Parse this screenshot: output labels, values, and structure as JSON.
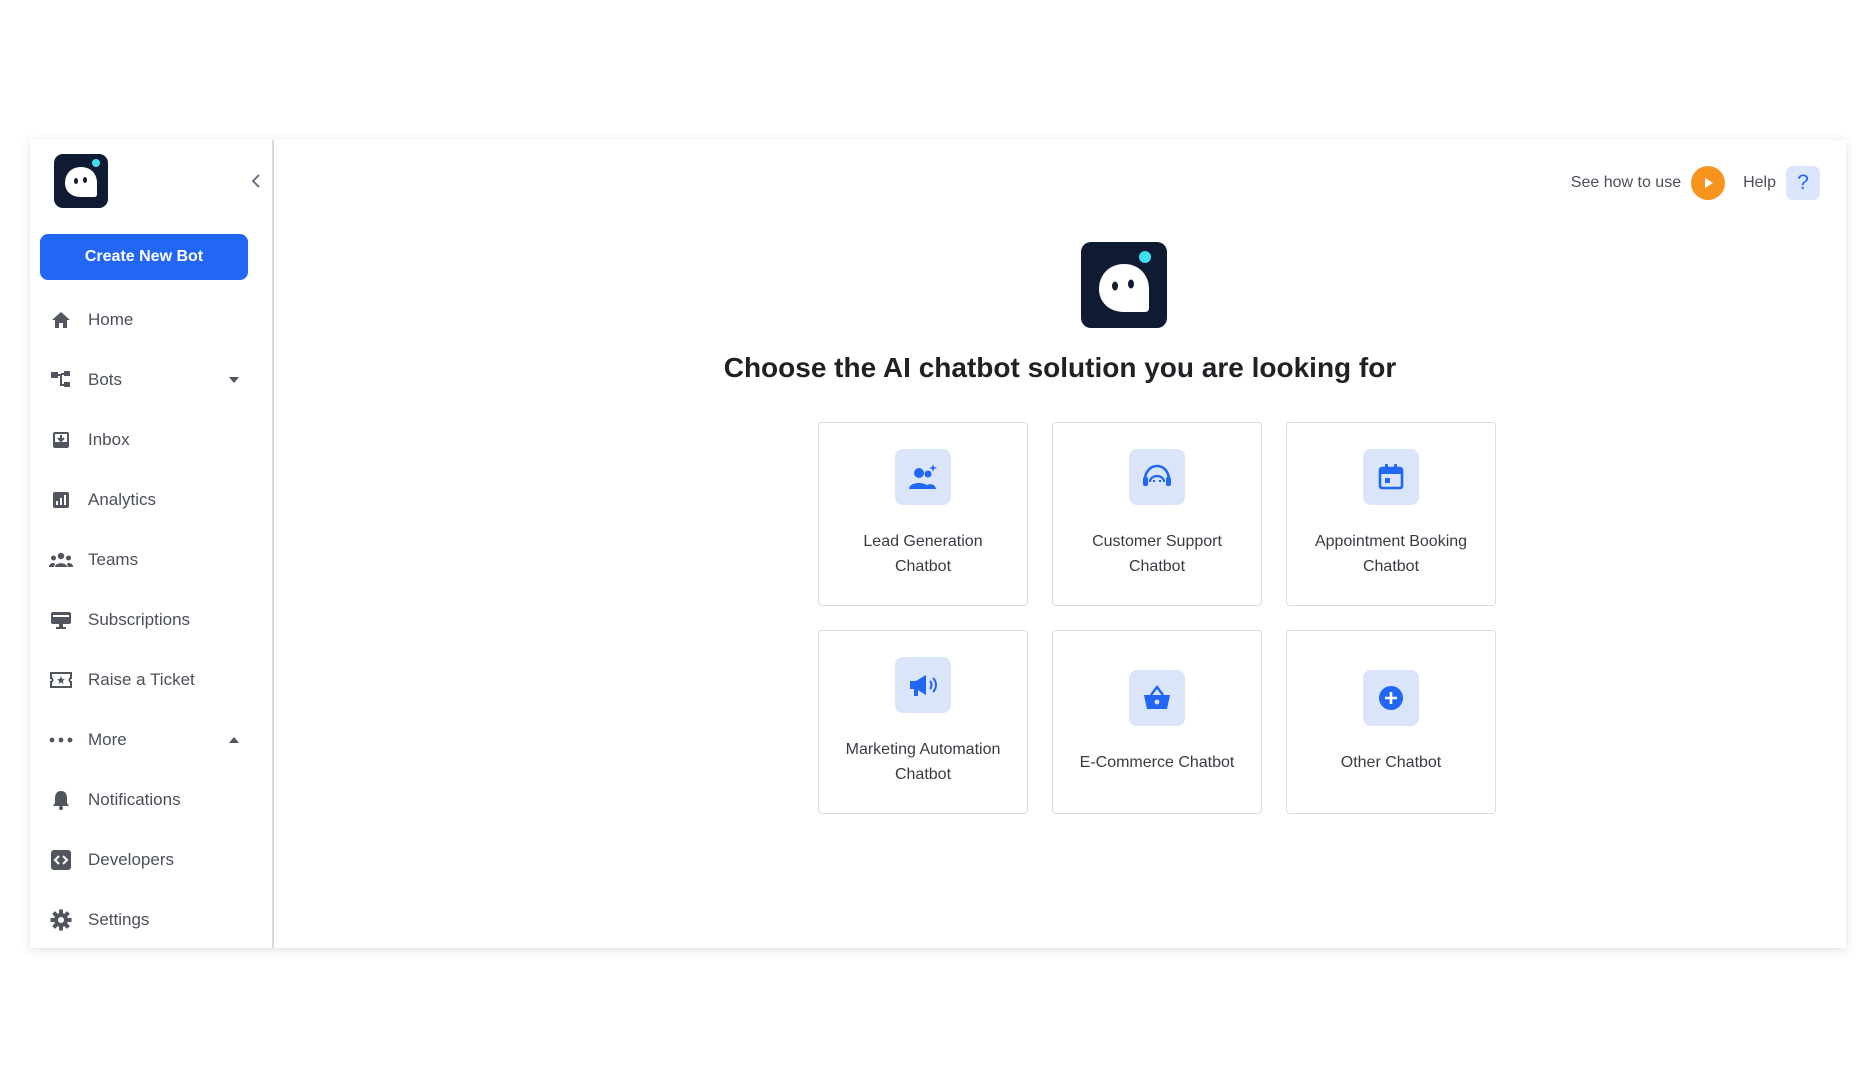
{
  "sidebar": {
    "create_button": "Create New Bot",
    "items": [
      {
        "label": "Home"
      },
      {
        "label": "Bots"
      },
      {
        "label": "Inbox"
      },
      {
        "label": "Analytics"
      },
      {
        "label": "Teams"
      },
      {
        "label": "Subscriptions"
      },
      {
        "label": "Raise a Ticket"
      },
      {
        "label": "More"
      },
      {
        "label": "Notifications"
      },
      {
        "label": "Developers"
      },
      {
        "label": "Settings"
      }
    ]
  },
  "topbar": {
    "see_how": "See how to use",
    "help": "Help",
    "help_glyph": "?"
  },
  "main": {
    "heading": "Choose the AI chatbot solution you are looking for",
    "cards": [
      {
        "line1": "Lead Generation",
        "line2": "Chatbot",
        "icon": "lead-generation-icon"
      },
      {
        "line1": "Customer Support",
        "line2": "Chatbot",
        "icon": "headset-icon"
      },
      {
        "line1": "Appointment Booking",
        "line2": "Chatbot",
        "icon": "calendar-icon"
      },
      {
        "line1": "Marketing Automation",
        "line2": "Chatbot",
        "icon": "megaphone-icon"
      },
      {
        "line1": "E-Commerce Chatbot",
        "line2": "",
        "icon": "basket-icon"
      },
      {
        "line1": "Other Chatbot",
        "line2": "",
        "icon": "plus-circle-icon"
      }
    ]
  },
  "colors": {
    "accent": "#2167f4",
    "logo_bg": "#0f1b33",
    "play": "#f7941d",
    "icon_tile": "#dae5fa"
  }
}
